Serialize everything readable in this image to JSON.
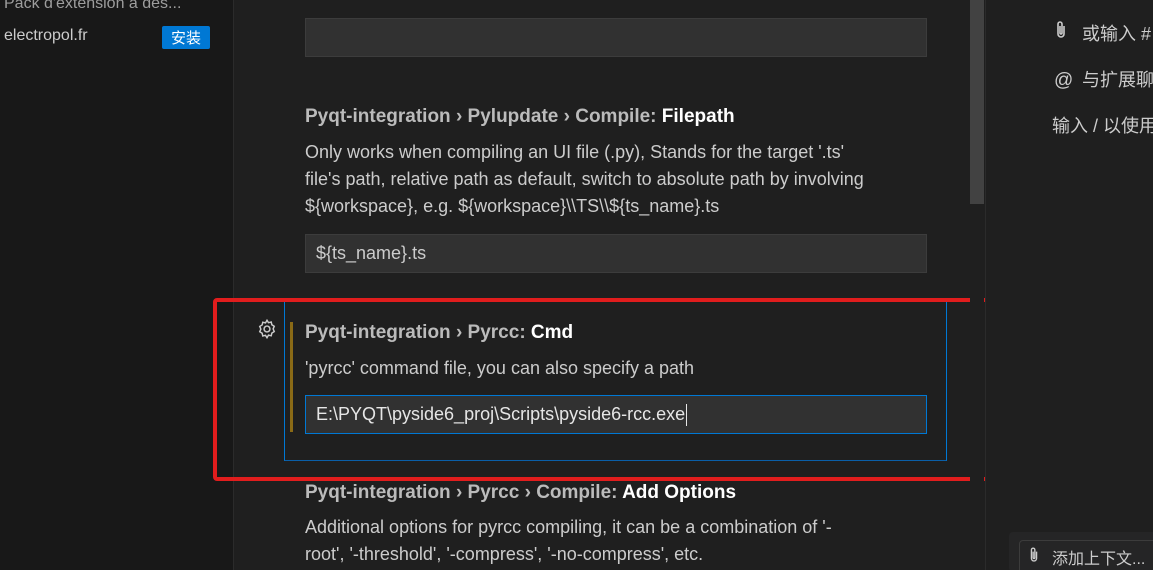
{
  "left_sidebar": {
    "ext_description": "Pack d'extension à des...",
    "ext_publisher": "electropol.fr",
    "install_label": "安装"
  },
  "settings": {
    "prev_input_value": "",
    "filepath": {
      "breadcrumb": "Pyqt-integration › Pylupdate › Compile: ",
      "leaf": "Filepath",
      "desc_line1": "Only works when compiling an UI file (.py), Stands for the target '.ts'",
      "desc_line2": "file's path, relative path as default, switch to absolute path by involving",
      "desc_line3": "${workspace}, e.g. ${workspace}\\\\TS\\\\${ts_name}.ts",
      "value": "${ts_name}.ts"
    },
    "pyrcc_cmd": {
      "breadcrumb": "Pyqt-integration › Pyrcc: ",
      "leaf": "Cmd",
      "desc": "'pyrcc' command file, you can also specify a path",
      "value": "E:\\PYQT\\pyside6_proj\\Scripts\\pyside6-rcc.exe"
    },
    "add_options": {
      "breadcrumb": "Pyqt-integration › Pyrcc › Compile: ",
      "leaf": "Add Options",
      "desc_line1": "Additional options for pyrcc compiling, it can be a combination of '-",
      "desc_line2": "root', '-threshold', '-compress', '-no-compress', etc."
    }
  },
  "right_panel": {
    "line1": "或输入 #",
    "line2": "与扩展聊",
    "line3": "输入 / 以使用",
    "chip_label": "添加上下文..."
  },
  "colors": {
    "accent": "#0078d4",
    "highlight_box": "#e11d1d",
    "modified_indicator": "#8a6a16"
  }
}
